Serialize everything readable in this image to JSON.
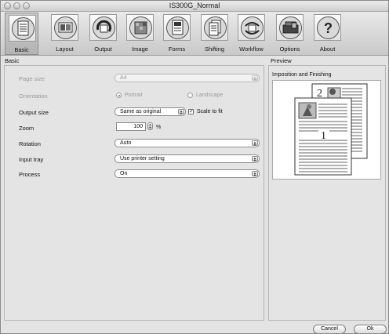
{
  "window": {
    "title": "IS300G_Normal"
  },
  "toolbar": {
    "tabs": [
      {
        "label": "Basic",
        "icon": "basic-icon"
      },
      {
        "label": "Layout",
        "icon": "layout-icon"
      },
      {
        "label": "Output",
        "icon": "output-icon"
      },
      {
        "label": "Image",
        "icon": "image-icon"
      },
      {
        "label": "Forms",
        "icon": "forms-icon"
      },
      {
        "label": "Shifting",
        "icon": "shifting-icon"
      },
      {
        "label": "Workflow",
        "icon": "workflow-icon"
      },
      {
        "label": "Options",
        "icon": "options-icon"
      },
      {
        "label": "About",
        "icon": "about-icon"
      }
    ],
    "active": "Basic"
  },
  "left": {
    "section_title": "Basic",
    "page_size": {
      "label": "Page size",
      "value": "A4"
    },
    "orientation": {
      "label": "Orientation",
      "portrait": "Portrait",
      "landscape": "Landscape"
    },
    "output_size": {
      "label": "Output size",
      "value": "Same as original",
      "scale_to_fit": "Scale to fit"
    },
    "zoom": {
      "label": "Zoom",
      "value": "100",
      "unit": "%"
    },
    "rotation": {
      "label": "Rotation",
      "value": "Auto"
    },
    "input_tray": {
      "label": "Input tray",
      "value": "Use printer setting"
    },
    "process": {
      "label": "Process",
      "value": "On"
    }
  },
  "right": {
    "section_title": "Preview",
    "preview_title": "Imposition and Finishing",
    "page_numbers": [
      "2",
      "1"
    ]
  },
  "buttons": {
    "cancel": "Cancel",
    "ok": "Ok"
  }
}
